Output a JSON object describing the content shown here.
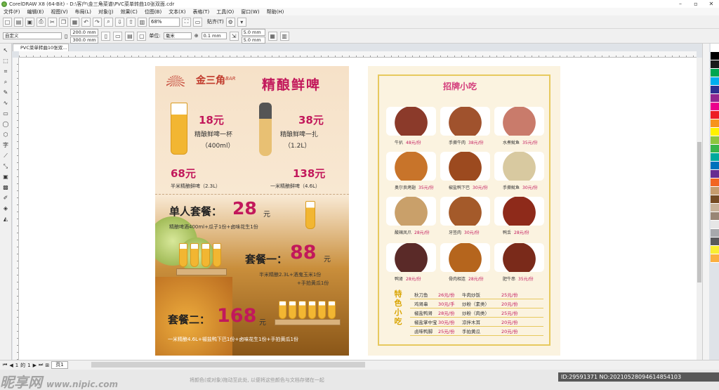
{
  "window": {
    "title": "CorelDRAW X8 (64-Bit) - D:\\客户\\金三角菜谱\\PVC菜单转曲10张双面.cdr"
  },
  "menu": [
    "文件(F)",
    "编辑(E)",
    "视图(V)",
    "布局(L)",
    "对象(J)",
    "效果(C)",
    "位图(B)",
    "文本(X)",
    "表格(T)",
    "工具(O)",
    "窗口(W)",
    "帮助(H)"
  ],
  "toolbar": {
    "zoom": "68%",
    "snap": "贴齐(T)"
  },
  "propbar": {
    "preset": "自定义",
    "width": "200.0 mm",
    "height": "300.0 mm",
    "units_label": "单位:",
    "units": "毫米",
    "nudge": "0.1 mm",
    "dup_x": "5.0 mm",
    "dup_y": "5.0 mm"
  },
  "doc_tab": "PVC菜单转曲10张双...",
  "page_nav": {
    "pos": "1",
    "of": "的",
    "total": "1",
    "tab": "页1"
  },
  "statusbar": {
    "hint": "将颜色(或对象)拖动至此处, 以便将这些颜色与文档存储在一起"
  },
  "watermark": {
    "brand": "昵享网",
    "site": "www.nipic.com",
    "id": "ID:29591371 NO:20210528094614854103"
  },
  "palette": [
    "#ffffff",
    "#000000",
    "#1a1a1a",
    "#00a651",
    "#00aeef",
    "#2e3192",
    "#92278f",
    "#ec008c",
    "#ed1c24",
    "#f7941d",
    "#fff200",
    "#8dc63f",
    "#39b54a",
    "#00a99d",
    "#0072bc",
    "#662d91",
    "#f26522",
    "#c69c6d",
    "#754c24",
    "#c7b299",
    "#998675",
    "#e6e6e6",
    "#a7a9ac",
    "#58595b",
    "#f9ed32",
    "#fbb040"
  ],
  "left_page": {
    "logo": "金三角",
    "logo_sub": "BAR",
    "title": "精酿鲜啤",
    "items": [
      {
        "price": "18元",
        "name": "精酿鲜啤一杯",
        "size": "（400ml）"
      },
      {
        "price": "38元",
        "name": "精酿鲜啤一扎",
        "size": "（1.2L）"
      },
      {
        "price": "68元",
        "name": "半米精酿鲜啤（2.3L）"
      },
      {
        "price": "138元",
        "name": "一米精酿鲜啤（4.6L）"
      }
    ],
    "set1": {
      "label": "单人套餐：",
      "price": "28",
      "unit": "元",
      "desc": "精酿啤酒400ml+瓜子1份+卤味花生1份"
    },
    "set2": {
      "label": "套餐一：",
      "price": "88",
      "unit": "元",
      "desc1": "半米精酿2.3L+酒鬼玉米1份",
      "desc2": "+手拍黄瓜1份"
    },
    "set3": {
      "label": "套餐二：",
      "price": "168",
      "unit": "元",
      "desc": "一米精酿4.6L+椒盐鸭下巴1份+卤味花生1份+手拍黄瓜1份"
    }
  },
  "right_page": {
    "title": "招牌小吃",
    "foods": [
      {
        "name": "牛扒",
        "price": "48元/份",
        "color": "#8b3a2a"
      },
      {
        "name": "手撕牛肉",
        "price": "38元/份",
        "color": "#a0522d"
      },
      {
        "name": "水煮鱿鱼",
        "price": "35元/份",
        "color": "#c97b6b"
      },
      {
        "name": "奥尔良烤翅",
        "price": "35元/份",
        "color": "#c8742a"
      },
      {
        "name": "椒盐鸭下巴",
        "price": "30元/份",
        "color": "#9c4a1f"
      },
      {
        "name": "手撕鱿鱼",
        "price": "30元/份",
        "color": "#d8c9a0"
      },
      {
        "name": "酸辣凤爪",
        "price": "28元/份",
        "color": "#c9a06a"
      },
      {
        "name": "牙签肉",
        "price": "30元/份",
        "color": "#a45a2a"
      },
      {
        "name": "鸭舌",
        "price": "28元/份",
        "color": "#8e2a1a"
      },
      {
        "name": "鸭肾",
        "price": "28元/份",
        "color": "#5a2a28"
      },
      {
        "name": "骨肉相连",
        "price": "28元/份",
        "color": "#b5651d"
      },
      {
        "name": "肥牛串",
        "price": "35元/份",
        "color": "#7a2a1a"
      }
    ],
    "special_label": "特色小吃",
    "specials": [
      {
        "a": "秋刀鱼",
        "ap": "26元/份",
        "b": "牛肉炒饭",
        "bp": "25元/份"
      },
      {
        "a": "鸡肾串",
        "ap": "30元/手",
        "b": "炒粉（素类）",
        "bp": "20元/份"
      },
      {
        "a": "椒盐鸭肾",
        "ap": "28元/份",
        "b": "炒粉（肉类）",
        "bp": "25元/份"
      },
      {
        "a": "椒盐掌中宝",
        "ap": "30元/份",
        "b": "凉拌木耳",
        "bp": "20元/份"
      },
      {
        "a": "卤味鸭脚",
        "ap": "25元/份",
        "b": "手拍黄瓜",
        "bp": "20元/份"
      }
    ]
  }
}
